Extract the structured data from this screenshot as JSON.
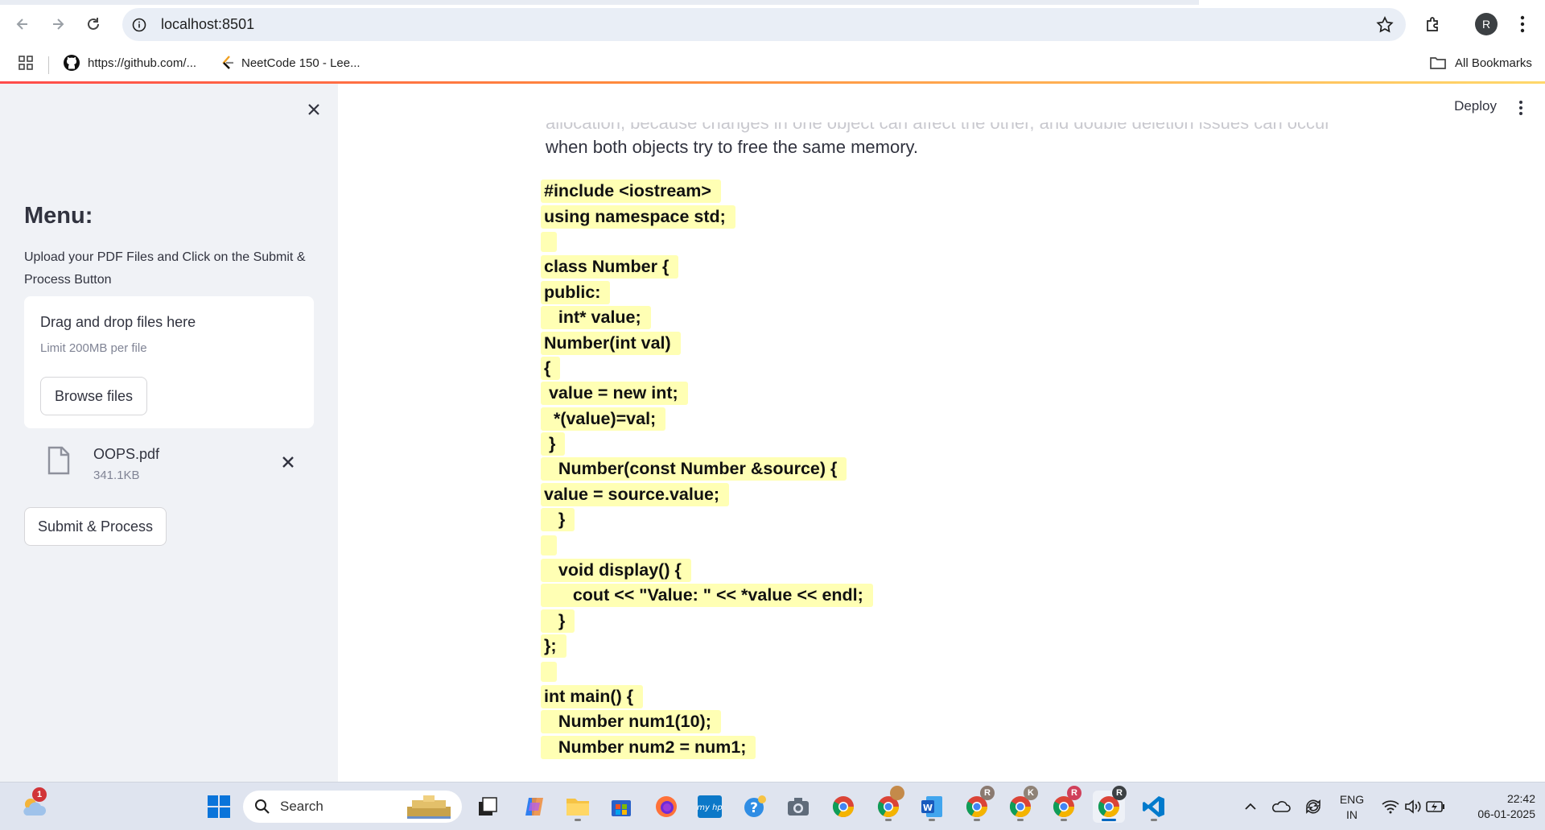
{
  "browser": {
    "url": "localhost:8501",
    "profile_initial": "R",
    "bookmarks": [
      {
        "label": "https://github.com/..."
      },
      {
        "label": "NeetCode 150 - Lee..."
      }
    ],
    "all_bookmarks_label": "All Bookmarks"
  },
  "sidebar": {
    "title": "Menu:",
    "description": "Upload your PDF Files and Click on the Submit & Process Button",
    "dropzone_title": "Drag and drop files here",
    "dropzone_limit": "Limit 200MB per file",
    "browse_label": "Browse files",
    "file": {
      "name": "OOPS.pdf",
      "size": "341.1KB"
    },
    "submit_label": "Submit & Process"
  },
  "main": {
    "deploy_label": "Deploy",
    "partial_line": "allocation, because changes in one object can affect the other, and double deletion issues can occur",
    "para_last_line": "when both objects try to free the same memory.",
    "code_lines": [
      "#include <iostream>",
      "using namespace std;",
      "",
      "class Number {",
      "public:",
      "   int* value;",
      "Number(int val)",
      "{",
      " value = new int;",
      "  *(value)=val;",
      " }",
      "   Number(const Number &source) {",
      "value = source.value;",
      "   }",
      "",
      "   void display() {",
      "      cout << \"Value: \" << *value << endl;",
      "   }",
      "};",
      "",
      "int main() {",
      "   Number num1(10);",
      "   Number num2 = num1;"
    ]
  },
  "taskbar": {
    "search_placeholder": "Search",
    "weather_badge": "1",
    "lang_line1": "ENG",
    "lang_line2": "IN",
    "time": "22:42",
    "date": "06-01-2025",
    "profile_badges": [
      "R",
      "K",
      "R",
      "R"
    ]
  },
  "colors": {
    "sidebar_bg": "#f0f2f6",
    "highlight": "#ffffb4",
    "accent": "#ff4b4b"
  }
}
